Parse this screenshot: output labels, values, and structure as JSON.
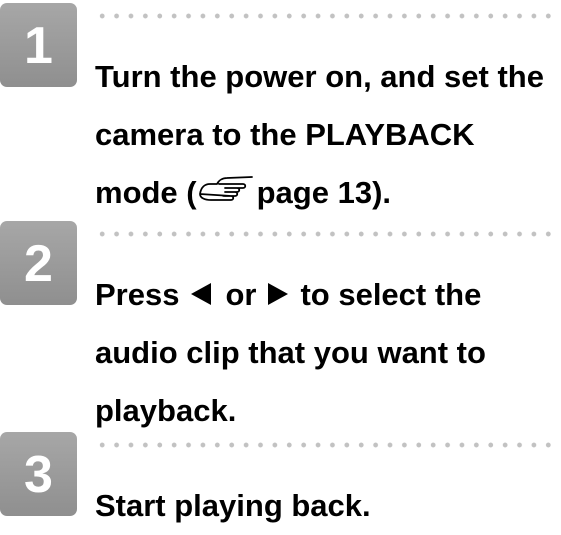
{
  "steps": [
    {
      "number": "1",
      "lines": [
        "Turn the power on, and set the",
        "camera to the PLAYBACK",
        "mode (",
        "page 13)."
      ]
    },
    {
      "number": "2",
      "press": "Press",
      "or": "or",
      "to_select": "to select the",
      "lines": [
        "audio clip that you want to",
        "playback."
      ],
      "icons": [
        "left-arrow-icon",
        "right-arrow-icon"
      ]
    },
    {
      "number": "3",
      "lines": [
        "Start playing back."
      ]
    }
  ],
  "colors": {
    "badge": "#9a9a9a",
    "dots": "#c2c2c2",
    "text": "#000000"
  },
  "icons": {
    "page_reference": "pointing-hand-icon"
  }
}
